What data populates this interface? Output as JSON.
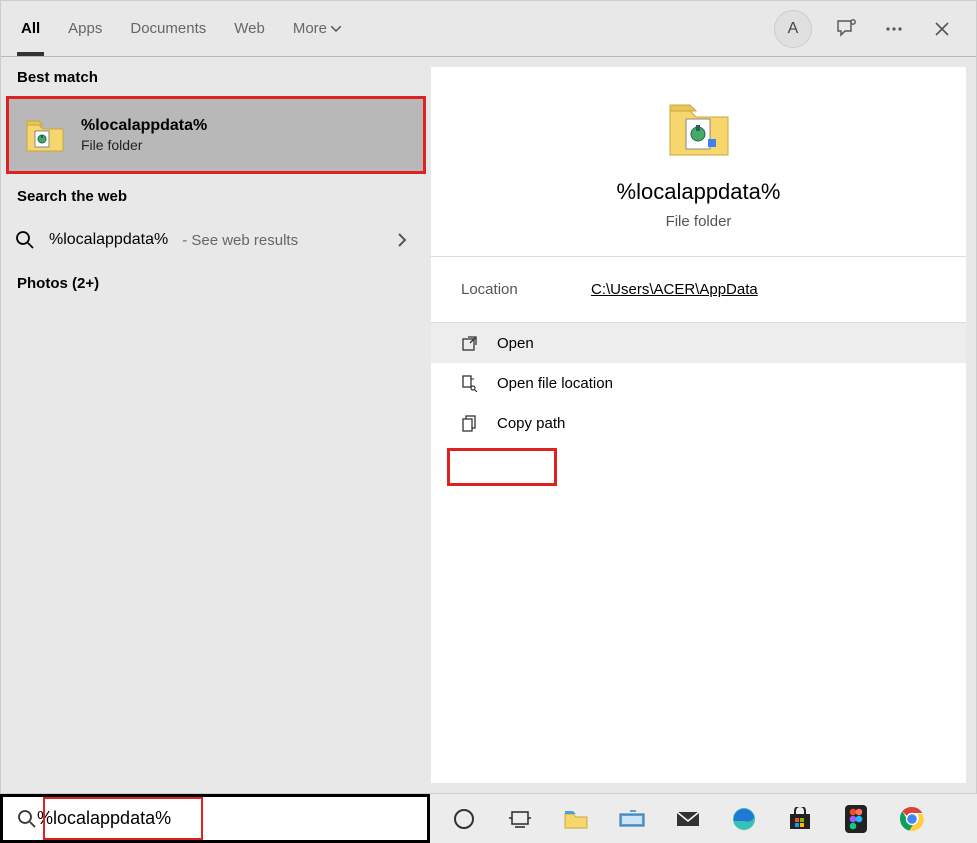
{
  "tabs": {
    "all": "All",
    "apps": "Apps",
    "documents": "Documents",
    "web": "Web",
    "more": "More"
  },
  "avatar_letter": "A",
  "sections": {
    "best_match": "Best match",
    "search_web": "Search the web",
    "photos": "Photos (2+)"
  },
  "best_match": {
    "title": "%localappdata%",
    "subtitle": "File folder"
  },
  "web_search": {
    "query": "%localappdata%",
    "hint": " - See web results"
  },
  "details": {
    "title": "%localappdata%",
    "subtitle": "File folder",
    "location_label": "Location",
    "location_path": "C:\\Users\\ACER\\AppData",
    "actions": {
      "open": "Open",
      "open_loc": "Open file location",
      "copy_path": "Copy path"
    }
  },
  "search_input_value": "%localappdata%"
}
